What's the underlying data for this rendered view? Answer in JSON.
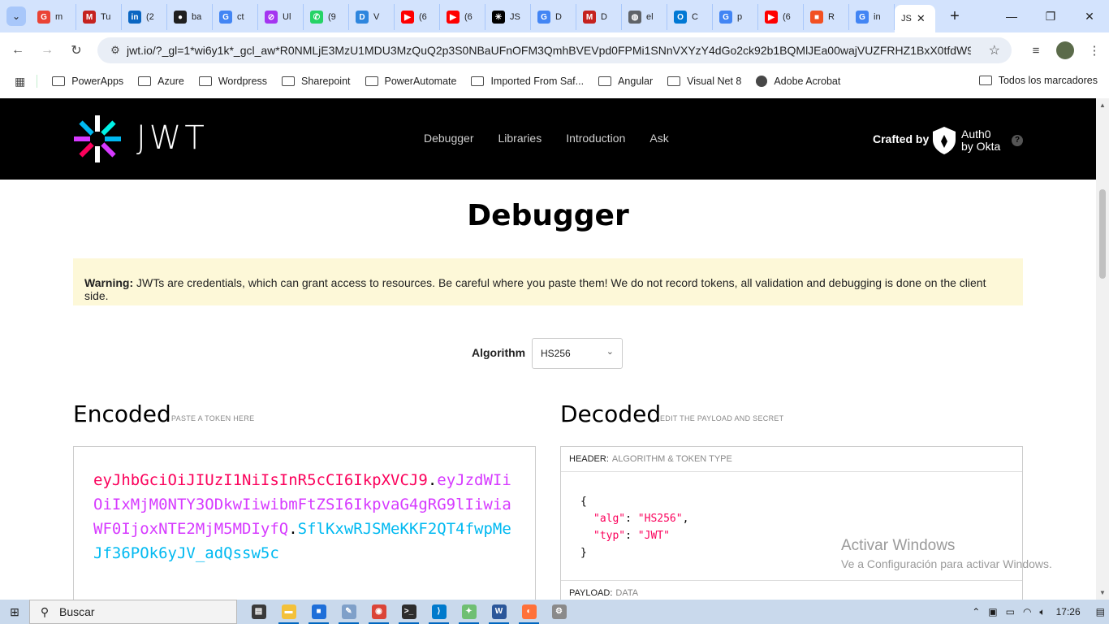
{
  "browser": {
    "tabs": [
      {
        "label": "m",
        "icon": "gmail-icon",
        "color": "#ea4335",
        "glyph": "G"
      },
      {
        "label": "Tu",
        "icon": "gmail-icon",
        "color": "#c5221f",
        "glyph": "M"
      },
      {
        "label": "(2",
        "icon": "linkedin-icon",
        "color": "#0a66c2",
        "glyph": "in"
      },
      {
        "label": "ba",
        "icon": "github-icon",
        "color": "#1f1f1f",
        "glyph": "●"
      },
      {
        "label": "ct",
        "icon": "google-icon",
        "color": "#4285f4",
        "glyph": "G"
      },
      {
        "label": "Ul",
        "icon": "udemy-icon",
        "color": "#a435f0",
        "glyph": "⊘"
      },
      {
        "label": "(9",
        "icon": "whatsapp-icon",
        "color": "#25d366",
        "glyph": "✆"
      },
      {
        "label": "V",
        "icon": "dev-icon",
        "color": "#2e86de",
        "glyph": "D"
      },
      {
        "label": "(6",
        "icon": "youtube-icon",
        "color": "#ff0000",
        "glyph": "▶"
      },
      {
        "label": "(6",
        "icon": "youtube-icon",
        "color": "#ff0000",
        "glyph": "▶"
      },
      {
        "label": "JS",
        "icon": "jwt-icon",
        "color": "#000000",
        "glyph": "✳"
      },
      {
        "label": "D",
        "icon": "google-docs-icon",
        "color": "#4285f4",
        "glyph": "G"
      },
      {
        "label": "D",
        "icon": "gmail-icon",
        "color": "#c5221f",
        "glyph": "M"
      },
      {
        "label": "el",
        "icon": "globe-icon",
        "color": "#5f6368",
        "glyph": "◍"
      },
      {
        "label": "C",
        "icon": "outlook-icon",
        "color": "#0078d4",
        "glyph": "O"
      },
      {
        "label": "p",
        "icon": "google-icon",
        "color": "#4285f4",
        "glyph": "G"
      },
      {
        "label": "(6",
        "icon": "youtube-icon",
        "color": "#ff0000",
        "glyph": "▶"
      },
      {
        "label": "R",
        "icon": "microsoft-icon",
        "color": "#f25022",
        "glyph": "■"
      },
      {
        "label": "in",
        "icon": "google-icon",
        "color": "#4285f4",
        "glyph": "G"
      }
    ],
    "active_tab": {
      "label": "JS",
      "close": "✕"
    },
    "new_tab": "+",
    "window_controls": {
      "minimize": "—",
      "restore": "❐",
      "close": "✕"
    },
    "url": "jwt.io/?_gl=1*wi6y1k*_gcl_aw*R0NMLjE3MzU1MDU3MzQuQ2p3S0NBaUFnOFM3QmhBVEVpd0FPMi1SNnVXYzY4dGo2ck92b1BQMlJEa00wajVUZFRHZ1BxX0tfdW9aLS1...",
    "bookmarks": [
      "PowerApps",
      "Azure",
      "Wordpress",
      "Sharepoint",
      "PowerAutomate",
      "Imported From Saf...",
      "Angular",
      "Visual Net 8",
      "Adobe Acrobat"
    ],
    "all_bookmarks": "Todos los marcadores"
  },
  "site": {
    "logo_text": "JWT",
    "nav": [
      "Debugger",
      "Libraries",
      "Introduction",
      "Ask"
    ],
    "crafted_by": "Crafted by",
    "auth0_line1": "Auth0",
    "auth0_line2": "by Okta",
    "help": "?"
  },
  "page": {
    "title": "Debugger",
    "warning_label": "Warning:",
    "warning_text": " JWTs are credentials, which can grant access to resources. Be careful where you paste them! We do not record tokens, all validation and debugging is done on the client side.",
    "algorithm_label": "Algorithm",
    "algorithm_value": "HS256",
    "encoded_title": "Encoded",
    "encoded_sub": "PASTE A TOKEN HERE",
    "decoded_title": "Decoded",
    "decoded_sub": "EDIT THE PAYLOAD AND SECRET",
    "token": {
      "header": "eyJhbGciOiJIUzI1NiIsInR5cCI6IkpXVCJ9",
      "payload": "eyJzdWIiOiIxMjM0NTY3ODkwIiwibmFtZSI6IkpvaG4gRG9lIiwiaWF0IjoxNTE2MjM5MDIyfQ",
      "signature": "SflKxwRJSMeKKF2QT4fwpMeJf36POk6yJV_adQssw5c"
    },
    "header_panel": {
      "label": "HEADER:",
      "sub": "ALGORITHM & TOKEN TYPE"
    },
    "header_json": {
      "alg_key": "\"alg\"",
      "alg_val": "\"HS256\"",
      "typ_key": "\"typ\"",
      "typ_val": "\"JWT\""
    },
    "payload_panel": {
      "label": "PAYLOAD:",
      "sub": "DATA"
    }
  },
  "watermark": {
    "line1": "Activar Windows",
    "line2": "Ve a Configuración para activar Windows."
  },
  "taskbar": {
    "search_placeholder": "Buscar",
    "apps": [
      {
        "icon": "task-view-icon",
        "color": "#3a3a3a",
        "glyph": "▤"
      },
      {
        "icon": "file-explorer-icon",
        "color": "#f3c13a",
        "glyph": "▬"
      },
      {
        "icon": "store-icon",
        "color": "#1e6fd9",
        "glyph": "■"
      },
      {
        "icon": "notepad-icon",
        "color": "#7fa0c9",
        "glyph": "✎"
      },
      {
        "icon": "chrome-icon",
        "color": "#db4437",
        "glyph": "◉"
      },
      {
        "icon": "terminal-icon",
        "color": "#2d2d2d",
        "glyph": ">_"
      },
      {
        "icon": "vscode-icon",
        "color": "#007acc",
        "glyph": "⟩"
      },
      {
        "icon": "paint-icon",
        "color": "#6fbf73",
        "glyph": "✦"
      },
      {
        "icon": "word-icon",
        "color": "#2b579a",
        "glyph": "W"
      },
      {
        "icon": "firefox-icon",
        "color": "#ff7139",
        "glyph": "◐"
      },
      {
        "icon": "network-app-icon",
        "color": "#8a8a8a",
        "glyph": "⚙"
      }
    ],
    "time": "17:26"
  },
  "colors": {
    "header": "#fb015b",
    "payload": "#d63aff",
    "signature": "#00b9f1",
    "warning_bg": "#fdf8d8"
  }
}
